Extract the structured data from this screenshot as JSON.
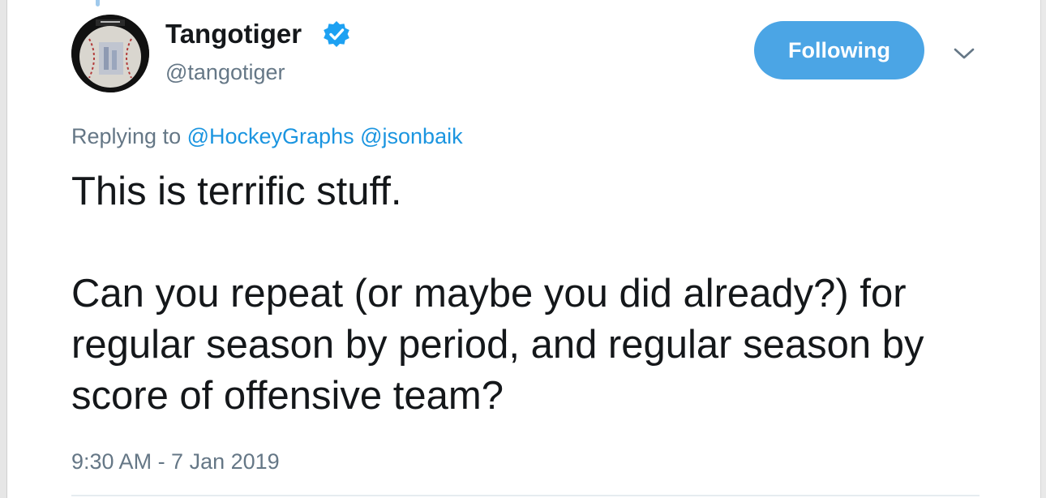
{
  "tweet": {
    "author": {
      "display_name": "Tangotiger",
      "handle": "@tangotiger",
      "verified_icon": "verified-badge-icon",
      "avatar_icon": "baseball-avatar"
    },
    "follow_button_label": "Following",
    "menu_icon": "chevron-down-icon",
    "reply": {
      "prefix": "Replying to",
      "mentions": [
        "@HockeyGraphs",
        "@jsonbaik"
      ]
    },
    "body": {
      "line1": "This is terrific stuff.",
      "line2": "Can you repeat (or maybe you did already?) for regular season by period, and regular season by score of offensive team?"
    },
    "timestamp": "9:30 AM - 7 Jan 2019"
  },
  "colors": {
    "accent": "#1b95e0",
    "button": "#4ba5e5",
    "text": "#14171a",
    "secondary": "#657786"
  }
}
